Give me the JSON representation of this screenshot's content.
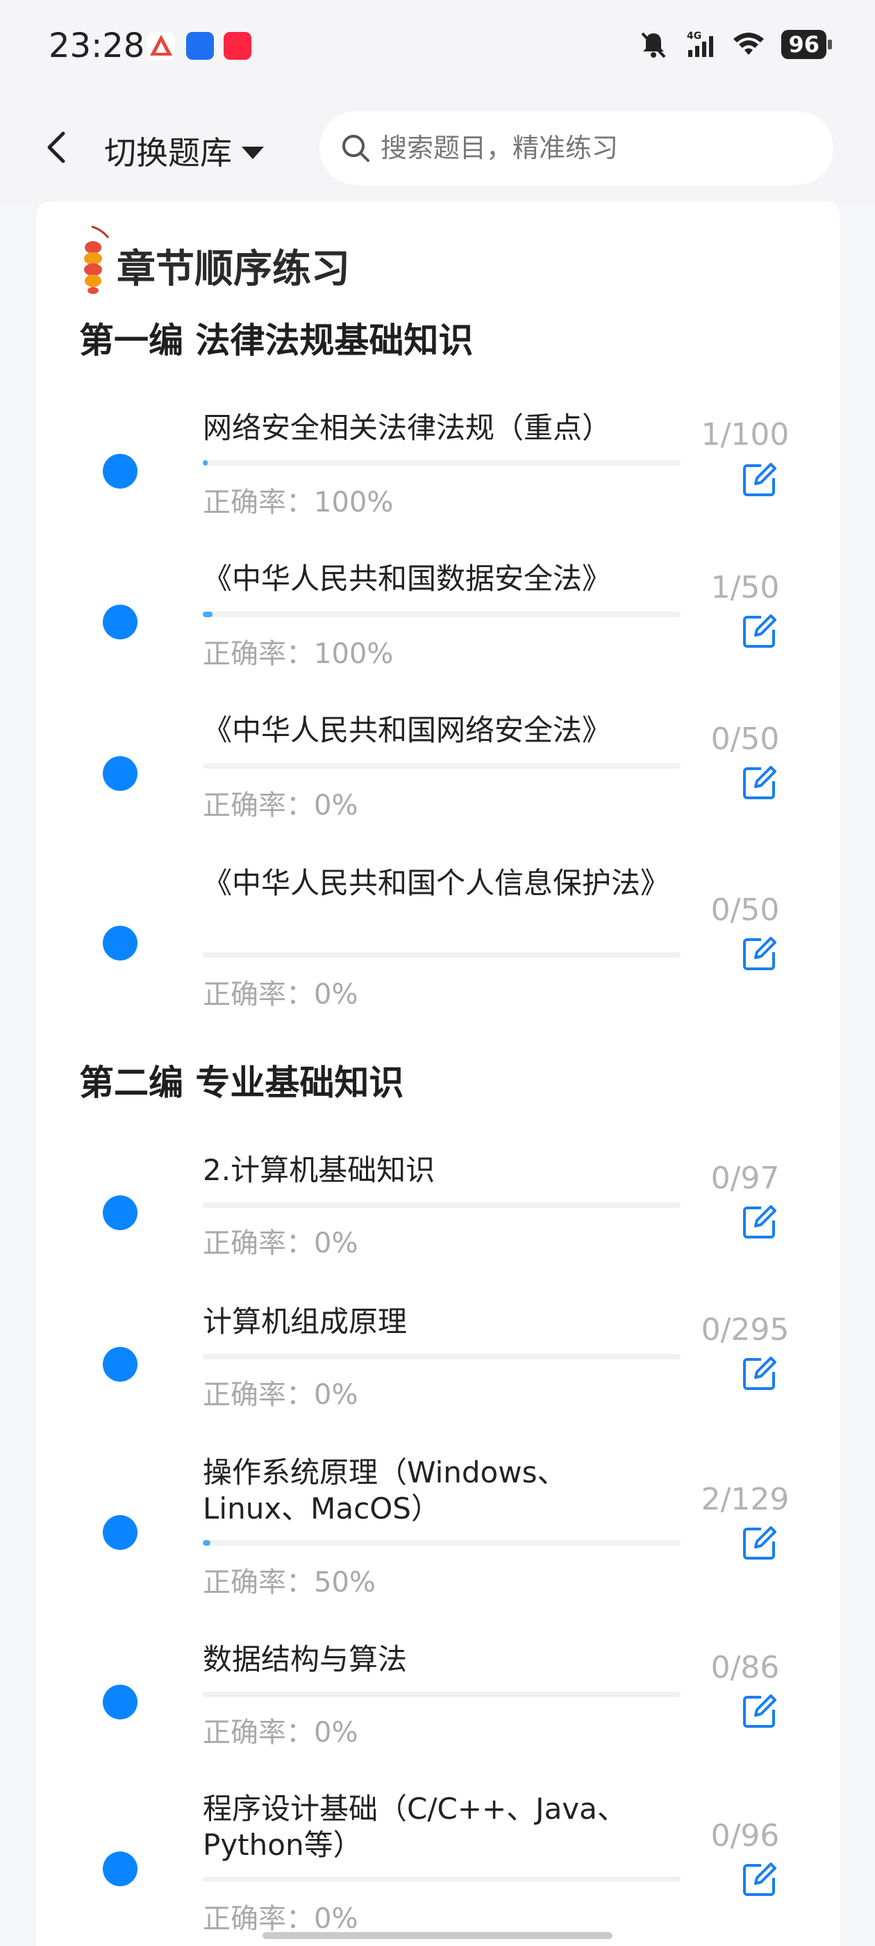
{
  "status_bar": {
    "time": "23:28",
    "signal_label": "4G",
    "battery": "96"
  },
  "nav": {
    "back_icon": "chevron-left-icon",
    "bank_switch_label": "切换题库",
    "search_placeholder": "搜索题目，精准练习"
  },
  "section": {
    "title": "章节顺序练习"
  },
  "accuracy_prefix": "正确率：",
  "parts": [
    {
      "title": "第一编 法律法规基础知识",
      "items": [
        {
          "title": "网络安全相关法律法规（重点）",
          "count": "1/100",
          "accuracy": "正确率：100%",
          "progress": 0.01
        },
        {
          "title": "《中华人民共和国数据安全法》",
          "count": "1/50",
          "accuracy": "正确率：100%",
          "progress": 0.02
        },
        {
          "title": "《中华人民共和国网络安全法》",
          "count": "0/50",
          "accuracy": "正确率：0%",
          "progress": 0
        },
        {
          "title": "《中华人民共和国个人信息保护法》",
          "count": "0/50",
          "accuracy": "正确率：0%",
          "progress": 0
        }
      ]
    },
    {
      "title": "第二编 专业基础知识",
      "items": [
        {
          "title": "2.计算机基础知识",
          "count": "0/97",
          "accuracy": "正确率：0%",
          "progress": 0
        },
        {
          "title": "计算机组成原理",
          "count": "0/295",
          "accuracy": "正确率：0%",
          "progress": 0
        },
        {
          "title": "操作系统原理（Windows、Linux、MacOS）",
          "count": "2/129",
          "accuracy": "正确率：50%",
          "progress": 0.0155
        },
        {
          "title": "数据结构与算法",
          "count": "0/86",
          "accuracy": "正确率：0%",
          "progress": 0
        },
        {
          "title": "程序设计基础（C/C++、Java、Python等）",
          "count": "0/96",
          "accuracy": "正确率：0%",
          "progress": 0
        }
      ]
    }
  ],
  "colors": {
    "accent": "#0a84ff",
    "progress_fill": "#4aa8f5",
    "muted_text": "#a9a9a9"
  }
}
